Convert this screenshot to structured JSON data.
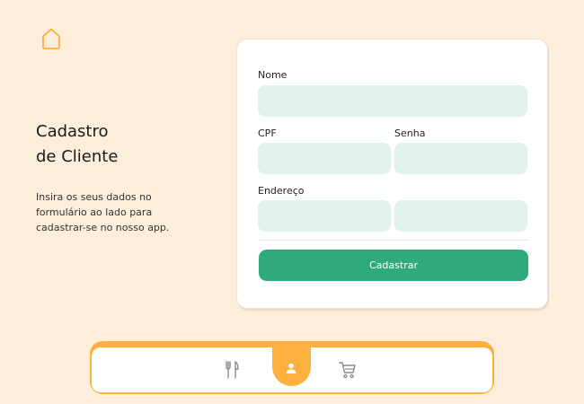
{
  "header": {
    "home_icon": "home-icon"
  },
  "intro": {
    "title_line1": "Cadastro",
    "title_line2": "de Cliente",
    "description": "Insira os seus dados no formulário ao lado para cadastrar-se no nosso app."
  },
  "form": {
    "nome_label": "Nome",
    "nome_value": "",
    "cpf_label": "CPF",
    "cpf_value": "",
    "senha_label": "Senha",
    "senha_value": "",
    "endereco_label": "Endereço",
    "endereco_value": "",
    "endereco2_value": "",
    "submit_label": "Cadastrar"
  },
  "nav": {
    "items": [
      {
        "icon": "fork-knife-icon",
        "active": false
      },
      {
        "icon": "user-icon",
        "active": true
      },
      {
        "icon": "cart-icon",
        "active": false
      }
    ]
  },
  "colors": {
    "background": "#fdeedb",
    "accent": "#fbb03f",
    "input_bg": "#e1f2ea",
    "button": "#2fab7b"
  }
}
